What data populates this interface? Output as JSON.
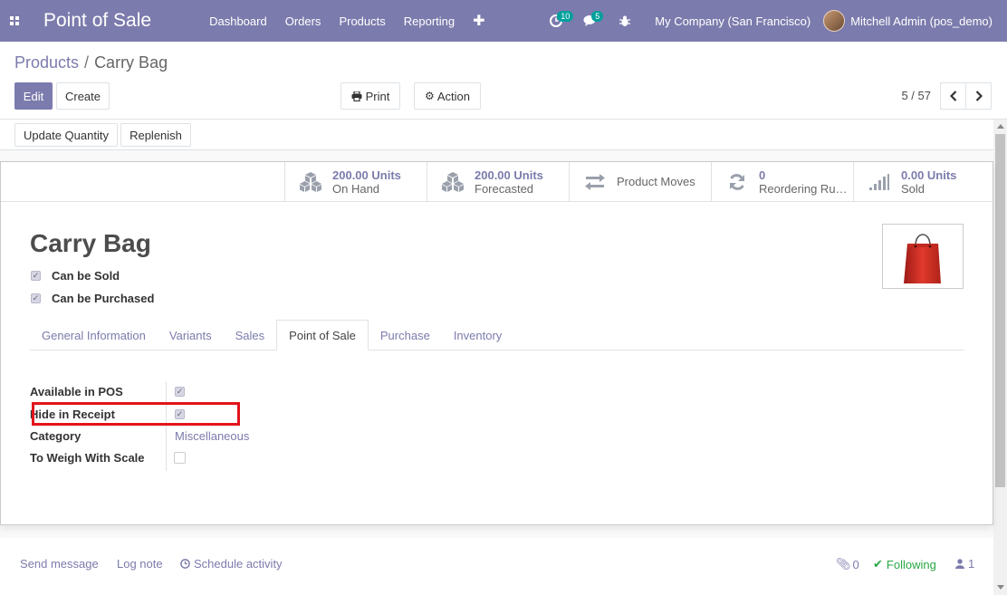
{
  "navbar": {
    "app_title": "Point of Sale",
    "menu": [
      "Dashboard",
      "Orders",
      "Products",
      "Reporting"
    ],
    "activity_count": "10",
    "messages_count": "5",
    "company": "My Company (San Francisco)",
    "user": "Mitchell Admin (pos_demo)"
  },
  "breadcrumb": {
    "parent": "Products",
    "current": "Carry Bag"
  },
  "buttons": {
    "edit": "Edit",
    "create": "Create",
    "print": "Print",
    "action": "Action"
  },
  "pager": {
    "value": "5 / 57"
  },
  "statusbar": {
    "update_qty": "Update Quantity",
    "replenish": "Replenish"
  },
  "smart_buttons": [
    {
      "value": "200.00 Units",
      "label": "On Hand",
      "icon": "cubes-icon"
    },
    {
      "value": "200.00 Units",
      "label": "Forecasted",
      "icon": "cubes-icon"
    },
    {
      "value": "",
      "label": "Product Moves",
      "icon": "exchange-icon"
    },
    {
      "value": "0",
      "label": "Reordering Ru…",
      "icon": "refresh-icon"
    },
    {
      "value": "0.00 Units",
      "label": "Sold",
      "icon": "signal-icon"
    }
  ],
  "product": {
    "name": "Carry Bag",
    "can_be_sold_label": "Can be Sold",
    "can_be_purchased_label": "Can be Purchased"
  },
  "tabs": [
    "General Information",
    "Variants",
    "Sales",
    "Point of Sale",
    "Purchase",
    "Inventory"
  ],
  "active_tab": "Point of Sale",
  "fields": {
    "available_in_pos": "Available in POS",
    "hide_in_receipt": "Hide in Receipt",
    "category_label": "Category",
    "category_value": "Miscellaneous",
    "to_weigh_label": "To Weigh With Scale"
  },
  "chatter": {
    "send_message": "Send message",
    "log_note": "Log note",
    "schedule_activity": "Schedule activity",
    "attachments": "0",
    "following": "Following",
    "followers": "1"
  },
  "colors": {
    "brand": "#7c7bad",
    "highlight": "#e2141b",
    "following": "#28a745"
  }
}
